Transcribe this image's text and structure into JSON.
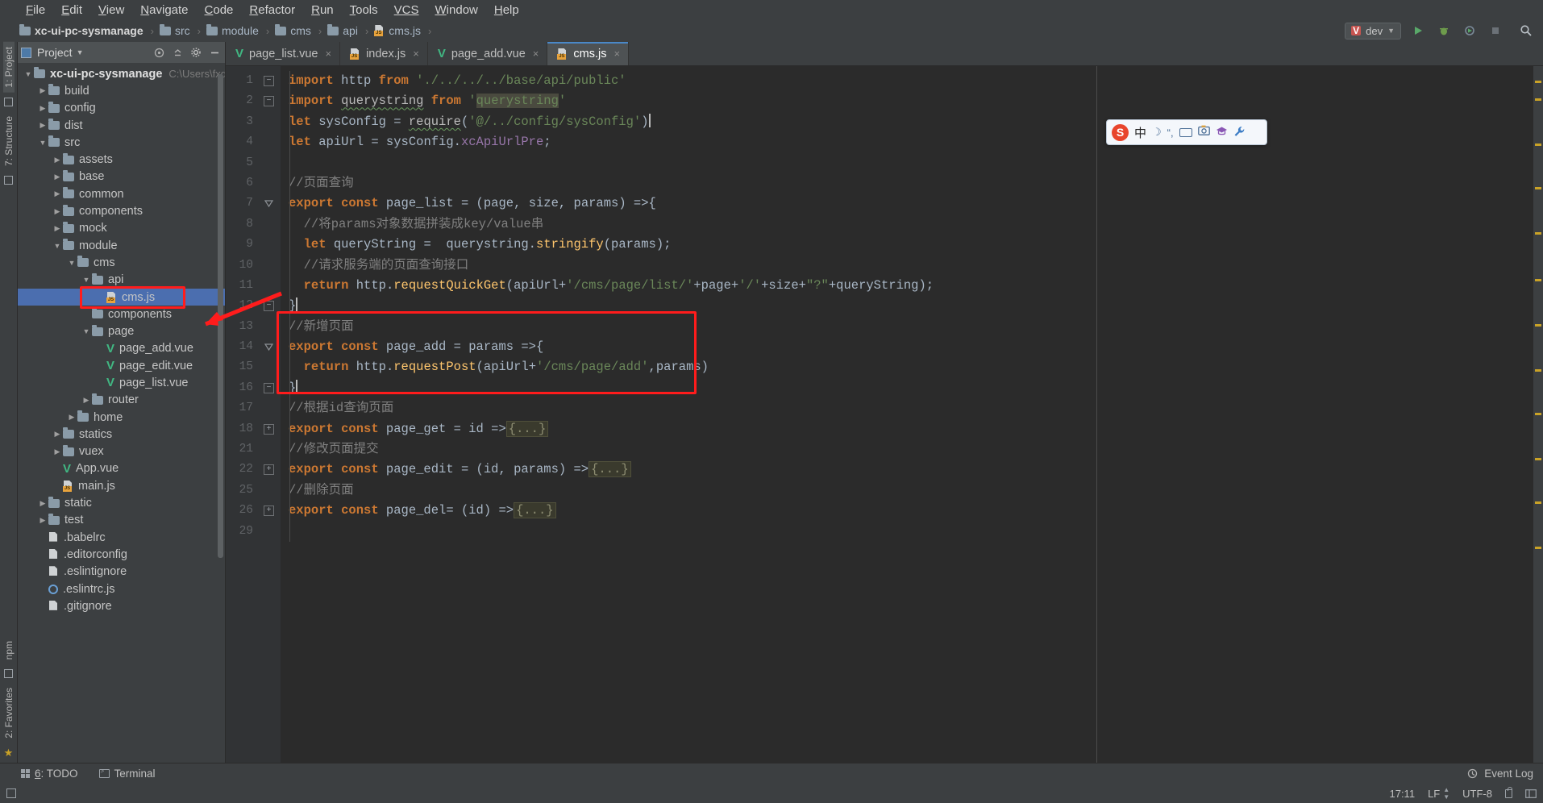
{
  "menu": {
    "items": [
      {
        "pre": "F",
        "rest": "ile"
      },
      {
        "pre": "E",
        "rest": "dit"
      },
      {
        "pre": "V",
        "rest": "iew"
      },
      {
        "pre": "N",
        "rest": "avigate"
      },
      {
        "pre": "C",
        "rest": "ode"
      },
      {
        "pre": "R",
        "rest": "efactor"
      },
      {
        "pre": "R",
        "rest": "un"
      },
      {
        "pre": "T",
        "rest": "ools"
      },
      {
        "pre": "VCS",
        "rest": ""
      },
      {
        "pre": "W",
        "rest": "indow"
      },
      {
        "pre": "H",
        "rest": "elp"
      }
    ]
  },
  "breadcrumb": {
    "items": [
      {
        "label": "xc-ui-pc-sysmanage",
        "icon": "folder-icon"
      },
      {
        "label": "src",
        "icon": "folder-icon"
      },
      {
        "label": "module",
        "icon": "folder-icon"
      },
      {
        "label": "cms",
        "icon": "folder-icon"
      },
      {
        "label": "api",
        "icon": "folder-icon"
      },
      {
        "label": "cms.js",
        "icon": "js-file-icon"
      }
    ],
    "separator": "›"
  },
  "toolbar": {
    "run_config": "dev",
    "run_button": "run-button",
    "debug_button": "debug-button",
    "coverage_button": "coverage-button",
    "stop_button": "stop-button",
    "search_button": "search-everywhere-button"
  },
  "left_strip": {
    "tabs": [
      "1: Project",
      "7: Structure"
    ],
    "bottom_tabs": [
      "npm",
      "2: Favorites"
    ]
  },
  "project_panel": {
    "title": "Project",
    "dropdown": "▾",
    "actions": [
      "target-icon",
      "collapse-all-icon",
      "settings-gear-icon",
      "hide-icon"
    ],
    "tree": [
      {
        "depth": 0,
        "arrow": "▼",
        "icon": "folder",
        "label": "xc-ui-pc-sysmanage",
        "bold": true,
        "path": "C:\\Users\\fxd\\D",
        "selected": false
      },
      {
        "depth": 1,
        "arrow": "▶",
        "icon": "folder",
        "label": "build",
        "bold": false,
        "path": "",
        "selected": false
      },
      {
        "depth": 1,
        "arrow": "▶",
        "icon": "folder",
        "label": "config",
        "bold": false,
        "path": "",
        "selected": false
      },
      {
        "depth": 1,
        "arrow": "▶",
        "icon": "folder",
        "label": "dist",
        "bold": false,
        "path": "",
        "selected": false
      },
      {
        "depth": 1,
        "arrow": "▼",
        "icon": "folder",
        "label": "src",
        "bold": false,
        "path": "",
        "selected": false
      },
      {
        "depth": 2,
        "arrow": "▶",
        "icon": "folder",
        "label": "assets",
        "bold": false,
        "path": "",
        "selected": false
      },
      {
        "depth": 2,
        "arrow": "▶",
        "icon": "folder",
        "label": "base",
        "bold": false,
        "path": "",
        "selected": false
      },
      {
        "depth": 2,
        "arrow": "▶",
        "icon": "folder",
        "label": "common",
        "bold": false,
        "path": "",
        "selected": false
      },
      {
        "depth": 2,
        "arrow": "▶",
        "icon": "folder",
        "label": "components",
        "bold": false,
        "path": "",
        "selected": false
      },
      {
        "depth": 2,
        "arrow": "▶",
        "icon": "folder",
        "label": "mock",
        "bold": false,
        "path": "",
        "selected": false
      },
      {
        "depth": 2,
        "arrow": "▼",
        "icon": "folder",
        "label": "module",
        "bold": false,
        "path": "",
        "selected": false
      },
      {
        "depth": 3,
        "arrow": "▼",
        "icon": "folder",
        "label": "cms",
        "bold": false,
        "path": "",
        "selected": false
      },
      {
        "depth": 4,
        "arrow": "▼",
        "icon": "folder",
        "label": "api",
        "bold": false,
        "path": "",
        "selected": false
      },
      {
        "depth": 5,
        "arrow": "",
        "icon": "js",
        "label": "cms.js",
        "bold": false,
        "path": "",
        "selected": true
      },
      {
        "depth": 4,
        "arrow": "",
        "icon": "folder",
        "label": "components",
        "bold": false,
        "path": "",
        "selected": false
      },
      {
        "depth": 4,
        "arrow": "▼",
        "icon": "folder",
        "label": "page",
        "bold": false,
        "path": "",
        "selected": false
      },
      {
        "depth": 5,
        "arrow": "",
        "icon": "vue",
        "label": "page_add.vue",
        "bold": false,
        "path": "",
        "selected": false
      },
      {
        "depth": 5,
        "arrow": "",
        "icon": "vue",
        "label": "page_edit.vue",
        "bold": false,
        "path": "",
        "selected": false
      },
      {
        "depth": 5,
        "arrow": "",
        "icon": "vue",
        "label": "page_list.vue",
        "bold": false,
        "path": "",
        "selected": false
      },
      {
        "depth": 4,
        "arrow": "▶",
        "icon": "folder",
        "label": "router",
        "bold": false,
        "path": "",
        "selected": false
      },
      {
        "depth": 3,
        "arrow": "▶",
        "icon": "folder",
        "label": "home",
        "bold": false,
        "path": "",
        "selected": false
      },
      {
        "depth": 2,
        "arrow": "▶",
        "icon": "folder",
        "label": "statics",
        "bold": false,
        "path": "",
        "selected": false
      },
      {
        "depth": 2,
        "arrow": "▶",
        "icon": "folder",
        "label": "vuex",
        "bold": false,
        "path": "",
        "selected": false
      },
      {
        "depth": 2,
        "arrow": "",
        "icon": "vue",
        "label": "App.vue",
        "bold": false,
        "path": "",
        "selected": false
      },
      {
        "depth": 2,
        "arrow": "",
        "icon": "js",
        "label": "main.js",
        "bold": false,
        "path": "",
        "selected": false
      },
      {
        "depth": 1,
        "arrow": "▶",
        "icon": "folder",
        "label": "static",
        "bold": false,
        "path": "",
        "selected": false
      },
      {
        "depth": 1,
        "arrow": "▶",
        "icon": "folder",
        "label": "test",
        "bold": false,
        "path": "",
        "selected": false
      },
      {
        "depth": 1,
        "arrow": "",
        "icon": "file",
        "label": ".babelrc",
        "bold": false,
        "path": "",
        "selected": false
      },
      {
        "depth": 1,
        "arrow": "",
        "icon": "file",
        "label": ".editorconfig",
        "bold": false,
        "path": "",
        "selected": false
      },
      {
        "depth": 1,
        "arrow": "",
        "icon": "file",
        "label": ".eslintignore",
        "bold": false,
        "path": "",
        "selected": false
      },
      {
        "depth": 1,
        "arrow": "",
        "icon": "circle",
        "label": ".eslintrc.js",
        "bold": false,
        "path": "",
        "selected": false
      },
      {
        "depth": 1,
        "arrow": "",
        "icon": "file",
        "label": ".gitignore",
        "bold": false,
        "path": "",
        "selected": false
      }
    ]
  },
  "editor": {
    "tabs": [
      {
        "label": "page_list.vue",
        "icon": "vue-file-icon",
        "active": false,
        "close": "×"
      },
      {
        "label": "index.js",
        "icon": "js-file-icon",
        "active": false,
        "close": "×"
      },
      {
        "label": "page_add.vue",
        "icon": "vue-file-icon",
        "active": false,
        "close": "×"
      },
      {
        "label": "cms.js",
        "icon": "js-file-icon",
        "active": true,
        "close": "×"
      }
    ],
    "line_numbers": [
      "1",
      "2",
      "3",
      "4",
      "5",
      "6",
      "7",
      "8",
      "9",
      "10",
      "11",
      "12",
      "13",
      "14",
      "15",
      "16",
      "17",
      "18",
      "21",
      "22",
      "25",
      "26",
      "29"
    ],
    "lines": [
      {
        "n": "1",
        "fold": "minus",
        "tokens": [
          {
            "t": "import ",
            "c": "kw"
          },
          {
            "t": "http ",
            "c": "ident"
          },
          {
            "t": "from ",
            "c": "kw"
          },
          {
            "t": "'./../../../base/api/public'",
            "c": "str"
          }
        ]
      },
      {
        "n": "2",
        "fold": "minus",
        "tokens": [
          {
            "t": "import ",
            "c": "kw"
          },
          {
            "t": "querystring",
            "c": "squig"
          },
          {
            "t": " ",
            "c": "ident"
          },
          {
            "t": "from ",
            "c": "kw"
          },
          {
            "t": "'",
            "c": "str"
          },
          {
            "t": "querystring",
            "c": "str hl"
          },
          {
            "t": "'",
            "c": "str"
          }
        ]
      },
      {
        "n": "3",
        "fold": "",
        "tokens": [
          {
            "t": "let ",
            "c": "kw"
          },
          {
            "t": "sysConfig = ",
            "c": "ident"
          },
          {
            "t": "require",
            "c": "squig"
          },
          {
            "t": "(",
            "c": "op"
          },
          {
            "t": "'@/../config/sysConfig'",
            "c": "str"
          },
          {
            "t": ")",
            "c": "op"
          },
          {
            "t": "CARET",
            "c": "caret"
          }
        ]
      },
      {
        "n": "4",
        "fold": "",
        "tokens": [
          {
            "t": "let ",
            "c": "kw"
          },
          {
            "t": "apiUrl = sysConfig.",
            "c": "ident"
          },
          {
            "t": "xcApiUrlPre",
            "c": "fld"
          },
          {
            "t": ";",
            "c": "op"
          }
        ]
      },
      {
        "n": "5",
        "fold": "",
        "tokens": []
      },
      {
        "n": "6",
        "fold": "",
        "tokens": [
          {
            "t": "//页面查询",
            "c": "cmt"
          }
        ]
      },
      {
        "n": "7",
        "fold": "tri",
        "tokens": [
          {
            "t": "export const ",
            "c": "kw"
          },
          {
            "t": "page_list",
            "c": "ident"
          },
          {
            "t": " = (",
            "c": "op"
          },
          {
            "t": "page",
            "c": "ident"
          },
          {
            "t": ", ",
            "c": "op"
          },
          {
            "t": "size",
            "c": "ident"
          },
          {
            "t": ", ",
            "c": "op"
          },
          {
            "t": "params",
            "c": "ident"
          },
          {
            "t": ") =>{",
            "c": "op"
          }
        ]
      },
      {
        "n": "8",
        "fold": "",
        "tokens": [
          {
            "t": "  //将params对象数据拼装成key/value串",
            "c": "cmt"
          }
        ]
      },
      {
        "n": "9",
        "fold": "",
        "tokens": [
          {
            "t": "  ",
            "c": "op"
          },
          {
            "t": "let ",
            "c": "kw"
          },
          {
            "t": "queryString =  querystring.",
            "c": "ident"
          },
          {
            "t": "stringify",
            "c": "fn"
          },
          {
            "t": "(",
            "c": "op"
          },
          {
            "t": "params",
            "c": "ident"
          },
          {
            "t": ");",
            "c": "op"
          }
        ]
      },
      {
        "n": "10",
        "fold": "",
        "tokens": [
          {
            "t": "  //请求服务端的页面查询接口",
            "c": "cmt"
          }
        ]
      },
      {
        "n": "11",
        "fold": "",
        "tokens": [
          {
            "t": "  ",
            "c": "op"
          },
          {
            "t": "return ",
            "c": "kw"
          },
          {
            "t": "http.",
            "c": "ident"
          },
          {
            "t": "requestQuickGet",
            "c": "fn"
          },
          {
            "t": "(",
            "c": "op"
          },
          {
            "t": "apiUrl",
            "c": "ident"
          },
          {
            "t": "+",
            "c": "op"
          },
          {
            "t": "'/cms/page/list/'",
            "c": "str"
          },
          {
            "t": "+",
            "c": "op"
          },
          {
            "t": "page",
            "c": "ident"
          },
          {
            "t": "+",
            "c": "op"
          },
          {
            "t": "'/'",
            "c": "str"
          },
          {
            "t": "+",
            "c": "op"
          },
          {
            "t": "size",
            "c": "ident"
          },
          {
            "t": "+",
            "c": "op"
          },
          {
            "t": "\"?\"",
            "c": "str"
          },
          {
            "t": "+",
            "c": "op"
          },
          {
            "t": "queryString",
            "c": "ident"
          },
          {
            "t": ");",
            "c": "op"
          }
        ]
      },
      {
        "n": "12",
        "fold": "minus",
        "tokens": [
          {
            "t": "}",
            "c": "op"
          },
          {
            "t": "CARET",
            "c": "caret"
          }
        ]
      },
      {
        "n": "13",
        "fold": "",
        "tokens": [
          {
            "t": "//新增页面",
            "c": "cmt"
          }
        ]
      },
      {
        "n": "14",
        "fold": "tri",
        "tokens": [
          {
            "t": "export const ",
            "c": "kw"
          },
          {
            "t": "page_add",
            "c": "ident"
          },
          {
            "t": " = ",
            "c": "op"
          },
          {
            "t": "params",
            "c": "ident"
          },
          {
            "t": " =>{",
            "c": "op"
          }
        ]
      },
      {
        "n": "15",
        "fold": "",
        "tokens": [
          {
            "t": "  ",
            "c": "op"
          },
          {
            "t": "return ",
            "c": "kw"
          },
          {
            "t": "http.",
            "c": "ident"
          },
          {
            "t": "requestPost",
            "c": "fn"
          },
          {
            "t": "(",
            "c": "op"
          },
          {
            "t": "apiUrl",
            "c": "ident"
          },
          {
            "t": "+",
            "c": "op"
          },
          {
            "t": "'/cms/page/add'",
            "c": "str"
          },
          {
            "t": ",",
            "c": "op"
          },
          {
            "t": "params",
            "c": "ident"
          },
          {
            "t": ")",
            "c": "op"
          }
        ]
      },
      {
        "n": "16",
        "fold": "minus",
        "tokens": [
          {
            "t": "}",
            "c": "op"
          },
          {
            "t": "CARET",
            "c": "caret"
          }
        ]
      },
      {
        "n": "17",
        "fold": "",
        "tokens": [
          {
            "t": "//根据id查询页面",
            "c": "cmt"
          }
        ]
      },
      {
        "n": "18",
        "fold": "plus",
        "tokens": [
          {
            "t": "export const ",
            "c": "kw"
          },
          {
            "t": "page_get",
            "c": "ident"
          },
          {
            "t": " = ",
            "c": "op"
          },
          {
            "t": "id",
            "c": "ident"
          },
          {
            "t": " =>",
            "c": "op"
          },
          {
            "t": "{...}",
            "c": "folded"
          }
        ]
      },
      {
        "n": "21",
        "fold": "",
        "tokens": [
          {
            "t": "//修改页面提交",
            "c": "cmt"
          }
        ]
      },
      {
        "n": "22",
        "fold": "plus",
        "tokens": [
          {
            "t": "export const ",
            "c": "kw"
          },
          {
            "t": "page_edit",
            "c": "ident"
          },
          {
            "t": " = (",
            "c": "op"
          },
          {
            "t": "id",
            "c": "ident"
          },
          {
            "t": ", ",
            "c": "op"
          },
          {
            "t": "params",
            "c": "ident"
          },
          {
            "t": ") =>",
            "c": "op"
          },
          {
            "t": "{...}",
            "c": "folded"
          }
        ]
      },
      {
        "n": "25",
        "fold": "",
        "tokens": [
          {
            "t": "//删除页面",
            "c": "cmt"
          }
        ]
      },
      {
        "n": "26",
        "fold": "plus",
        "tokens": [
          {
            "t": "export const ",
            "c": "kw"
          },
          {
            "t": "page_del",
            "c": "ident"
          },
          {
            "t": "= (",
            "c": "op"
          },
          {
            "t": "id",
            "c": "ident"
          },
          {
            "t": ") =>",
            "c": "op"
          },
          {
            "t": "{...}",
            "c": "folded"
          }
        ]
      },
      {
        "n": "29",
        "fold": "",
        "tokens": []
      }
    ]
  },
  "ime": {
    "logo": "S",
    "mode": "中",
    "moon": "☽",
    "quote": "“,",
    "keyboard": "keyboard-icon",
    "screenshot": "screenshot-icon",
    "hat": "hat-icon",
    "wrench": "wrench-icon"
  },
  "bottom_bar": {
    "todo": {
      "num": "6",
      "label": ": TODO"
    },
    "terminal": "Terminal",
    "event_log": "Event Log"
  },
  "status_bar": {
    "time": "17:11",
    "line_sep": "LF",
    "encoding": "UTF-8",
    "lock": "lock-icon",
    "layout": "layout-icon"
  },
  "annotations": {
    "color": "#ff1c1c",
    "sidebar_box": "cms-js-highlight-box",
    "code_box": "page-add-highlight-box",
    "arrow": "pointer-arrow"
  }
}
